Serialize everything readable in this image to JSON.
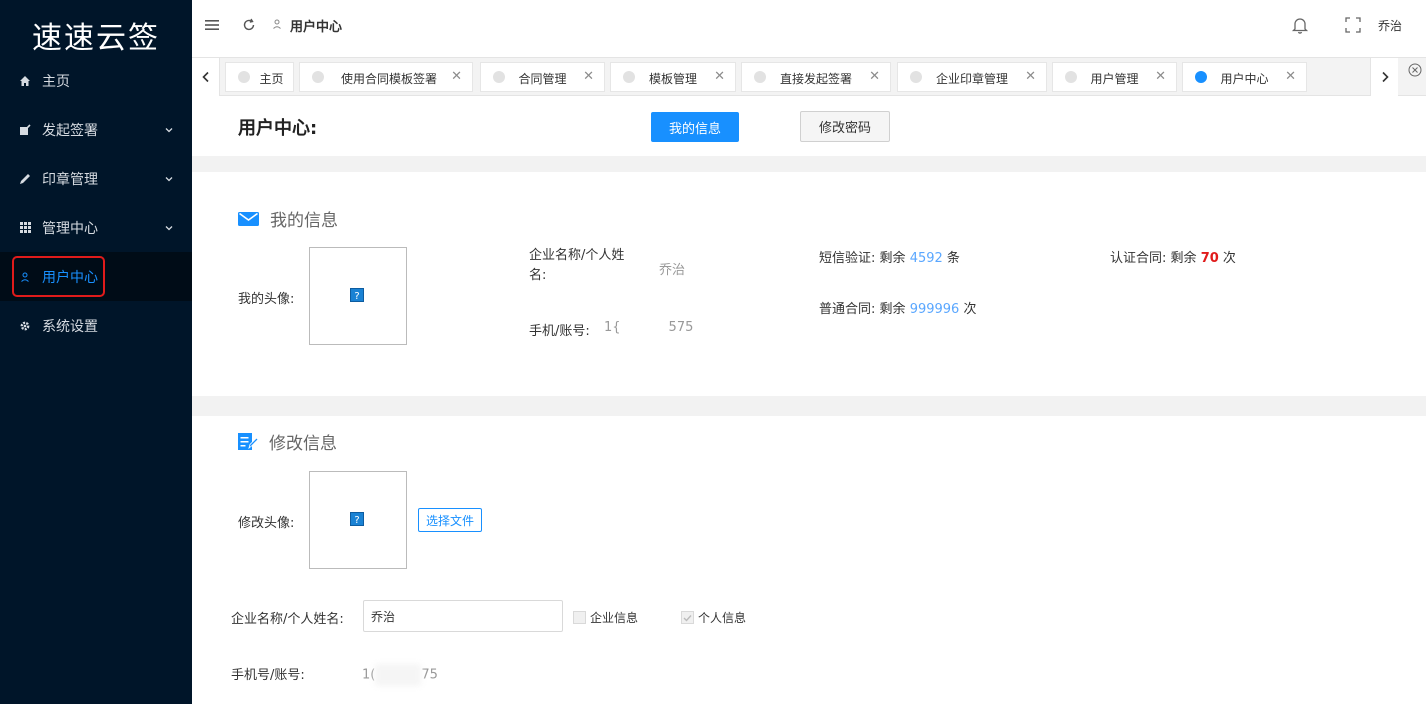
{
  "app": {
    "logo": "速速云签"
  },
  "sidebar": {
    "items": [
      {
        "label": "主页",
        "icon": "home-icon"
      },
      {
        "label": "发起签署",
        "icon": "edit-square-icon"
      },
      {
        "label": "印章管理",
        "icon": "pen-icon"
      },
      {
        "label": "管理中心",
        "icon": "grid-icon"
      },
      {
        "label": "用户中心",
        "icon": "user-icon"
      },
      {
        "label": "系统设置",
        "icon": "gear-icon"
      }
    ]
  },
  "header": {
    "breadcrumb": "用户中心",
    "username": "乔治"
  },
  "tabs": [
    {
      "label": "主页",
      "closable": false,
      "active": false
    },
    {
      "label": "使用合同模板签署",
      "closable": true,
      "active": false
    },
    {
      "label": "合同管理",
      "closable": true,
      "active": false
    },
    {
      "label": "模板管理",
      "closable": true,
      "active": false
    },
    {
      "label": "直接发起签署",
      "closable": true,
      "active": false
    },
    {
      "label": "企业印章管理",
      "closable": true,
      "active": false
    },
    {
      "label": "用户管理",
      "closable": true,
      "active": false
    },
    {
      "label": "用户中心",
      "closable": true,
      "active": true
    }
  ],
  "page": {
    "title": "用户中心:",
    "btn_info": "我的信息",
    "btn_password": "修改密码"
  },
  "info": {
    "section_title": "我的信息",
    "avatar_label": "我的头像:",
    "name_label": "企业名称/个人姓名:",
    "name_value": "乔治",
    "phone_label": "手机/账号:",
    "phone_prefix": "1{",
    "phone_suffix": "575",
    "sms_label": "短信验证:",
    "sms_remaining": "剩余",
    "sms_value": "4592",
    "sms_unit": "条",
    "normal_label": "普通合同:",
    "normal_remaining": "剩余",
    "normal_value": "999996",
    "normal_unit": "次",
    "cert_label": "认证合同:",
    "cert_remaining": "剩余",
    "cert_value": "70",
    "cert_unit": "次"
  },
  "edit": {
    "section_title": "修改信息",
    "avatar_label": "修改头像:",
    "file_button": "选择文件",
    "name_label": "企业名称/个人姓名:",
    "name_value": "乔治",
    "chk_company": "企业信息",
    "chk_personal": "个人信息",
    "phone_label": "手机号/账号:",
    "phone_prefix": "1(",
    "phone_suffix": "75"
  },
  "colors": {
    "sidebar_bg": "#001529",
    "accent": "#1890ff",
    "highlight": "#e01b1b"
  }
}
